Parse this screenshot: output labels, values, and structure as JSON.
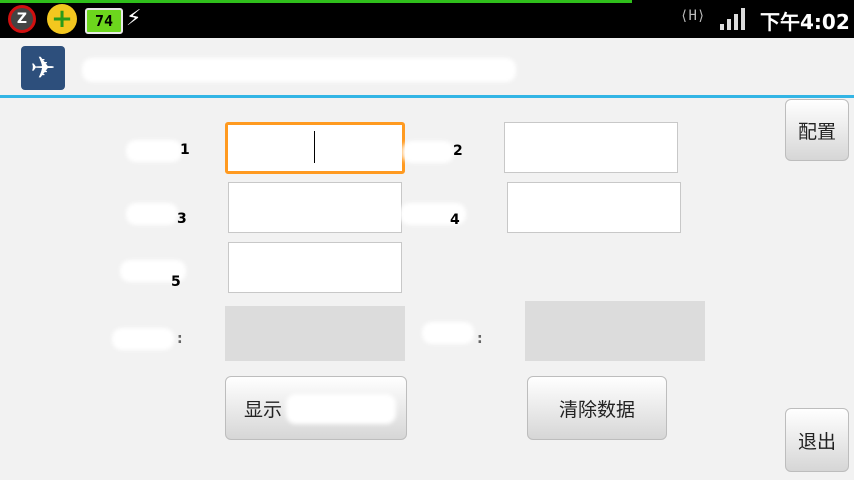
{
  "status_bar": {
    "battery_level": "74",
    "time": "下午4:02",
    "network_type": "H",
    "icons": [
      "z-notification-icon",
      "plus-app-icon",
      "battery-icon",
      "usb-icon",
      "signal-icon"
    ]
  },
  "app": {
    "icon": "airplane-icon",
    "title": ""
  },
  "form": {
    "field1_label": "1",
    "field2_label": "2",
    "field3_label": "3",
    "field4_label": "4",
    "field5_label": "5",
    "result1_label": ":",
    "result2_label": ":"
  },
  "buttons": {
    "config": "配置",
    "show": "显示",
    "clear": "清除数据",
    "exit": "退出"
  },
  "colors": {
    "accent": "#33b5e5",
    "focus": "#ff9a20",
    "progress": "#2fbf1b"
  }
}
